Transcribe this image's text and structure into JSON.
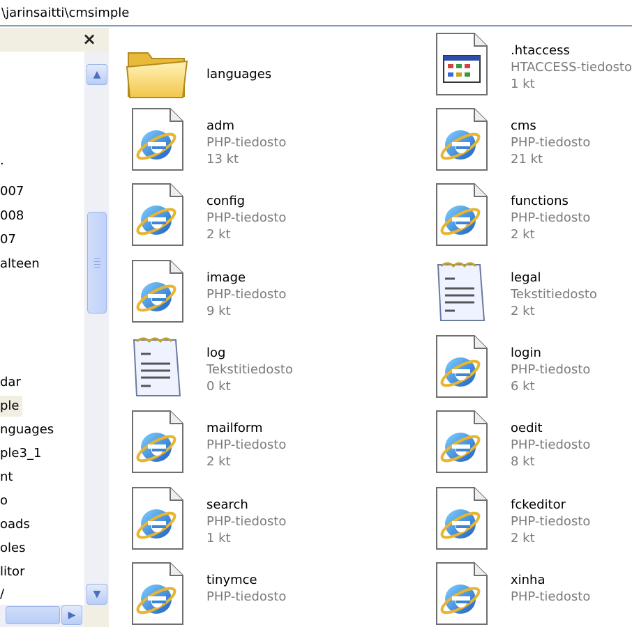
{
  "address": {
    "path": "\\jarinsaitti\\cmsimple"
  },
  "folders_pane": {
    "close_label": "×",
    "items": [
      {
        "label": "."
      },
      {
        "label": "007"
      },
      {
        "label": "008"
      },
      {
        "label": "07"
      },
      {
        "label": "alteen"
      },
      {
        "label": "dar"
      },
      {
        "label": "ple"
      },
      {
        "label": "nguages"
      },
      {
        "label": "ple3_1"
      },
      {
        "label": "nt"
      },
      {
        "label": "o"
      },
      {
        "label": "oads"
      },
      {
        "label": "oles"
      },
      {
        "label": "litor"
      },
      {
        "label": "/"
      }
    ],
    "scroll_up_glyph": "▲",
    "scroll_down_glyph": "▼",
    "scroll_right_glyph": "▶"
  },
  "files": [
    {
      "name": "languages",
      "type": "",
      "size": "",
      "icon": "folder-icon"
    },
    {
      "name": ".htaccess",
      "type": "HTACCESS-tiedosto",
      "size": "1 kt",
      "icon": "htaccess-file-icon"
    },
    {
      "name": "adm",
      "type": "PHP-tiedosto",
      "size": "13 kt",
      "icon": "php-file-icon"
    },
    {
      "name": "cms",
      "type": "PHP-tiedosto",
      "size": "21 kt",
      "icon": "php-file-icon"
    },
    {
      "name": "config",
      "type": "PHP-tiedosto",
      "size": "2 kt",
      "icon": "php-file-icon"
    },
    {
      "name": "functions",
      "type": "PHP-tiedosto",
      "size": "2 kt",
      "icon": "php-file-icon"
    },
    {
      "name": "image",
      "type": "PHP-tiedosto",
      "size": "9 kt",
      "icon": "php-file-icon"
    },
    {
      "name": "legal",
      "type": "Tekstitiedosto",
      "size": "2 kt",
      "icon": "text-file-icon"
    },
    {
      "name": "log",
      "type": "Tekstitiedosto",
      "size": "0 kt",
      "icon": "text-file-icon"
    },
    {
      "name": "login",
      "type": "PHP-tiedosto",
      "size": "6 kt",
      "icon": "php-file-icon"
    },
    {
      "name": "mailform",
      "type": "PHP-tiedosto",
      "size": "2 kt",
      "icon": "php-file-icon"
    },
    {
      "name": "oedit",
      "type": "PHP-tiedosto",
      "size": "8 kt",
      "icon": "php-file-icon"
    },
    {
      "name": "search",
      "type": "PHP-tiedosto",
      "size": "1 kt",
      "icon": "php-file-icon"
    },
    {
      "name": "fckeditor",
      "type": "PHP-tiedosto",
      "size": "2 kt",
      "icon": "php-file-icon"
    },
    {
      "name": "tinymce",
      "type": "PHP-tiedosto",
      "size": "",
      "icon": "php-file-icon"
    },
    {
      "name": "xinha",
      "type": "PHP-tiedosto",
      "size": "",
      "icon": "php-file-icon"
    }
  ],
  "colors": {
    "selection": "#f1efe2",
    "scroll_accent": "#9ab3e8",
    "ie_blue": "#2f6cc6",
    "secondary_text": "#7b7b7b"
  }
}
